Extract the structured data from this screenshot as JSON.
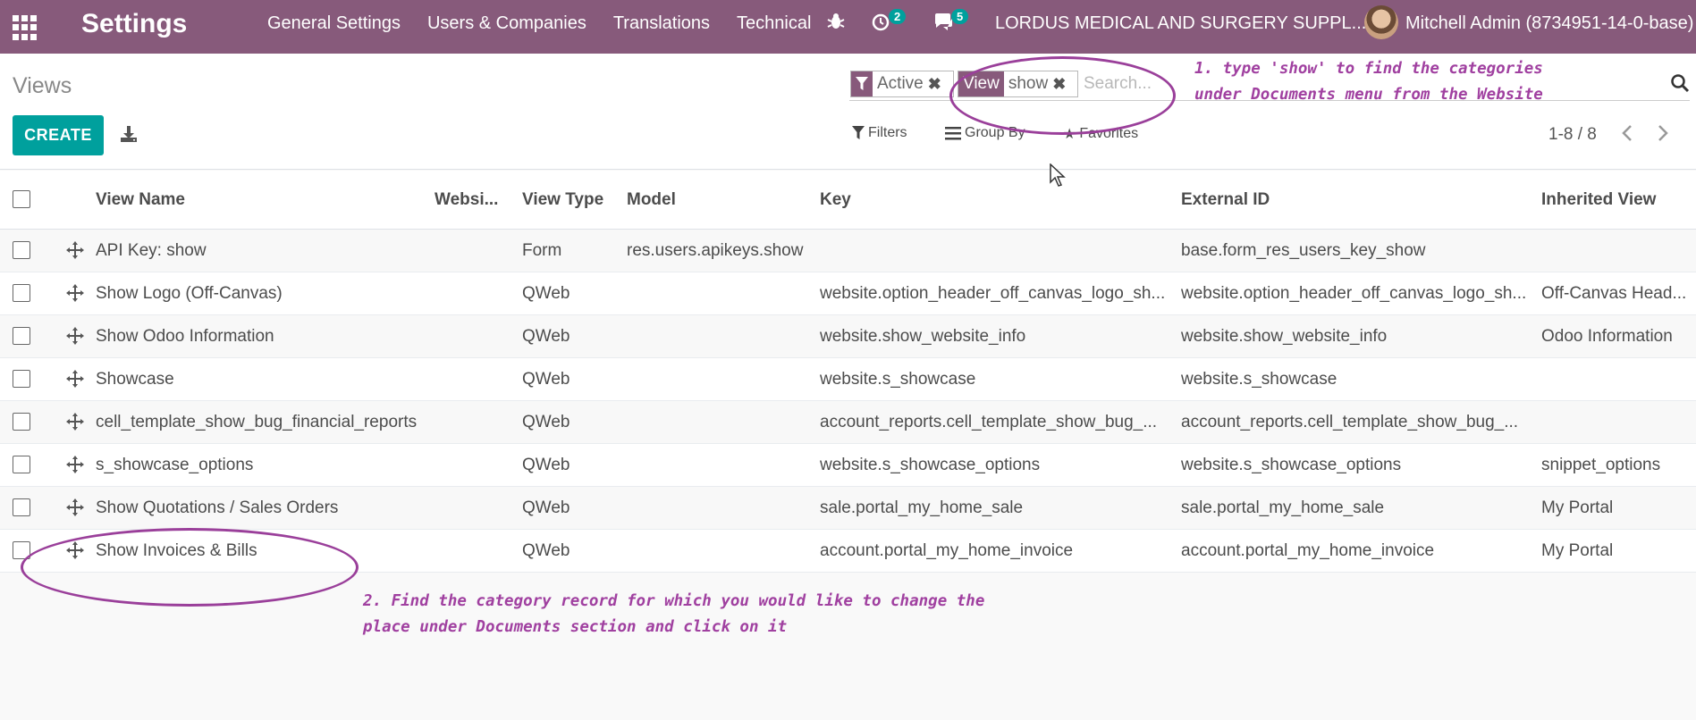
{
  "navbar": {
    "app_title": "Settings",
    "menu": [
      "General Settings",
      "Users & Companies",
      "Translations",
      "Technical"
    ],
    "activity_count": "2",
    "message_count": "5",
    "company": "LORDUS MEDICAL AND SURGERY SUPPL...",
    "user": "Mitchell Admin (8734951-14-0-base)"
  },
  "control": {
    "breadcrumb": "Views",
    "create_label": "CREATE",
    "facets": [
      {
        "label": "",
        "value": "Active"
      },
      {
        "label": "View",
        "value": "show"
      }
    ],
    "search_placeholder": "Search...",
    "filters_label": "Filters",
    "groupby_label": "Group By",
    "favorites_label": "Favorites",
    "pager": "1-8 / 8"
  },
  "table": {
    "headers": {
      "name": "View Name",
      "website": "Websi...",
      "type": "View Type",
      "model": "Model",
      "key": "Key",
      "external_id": "External ID",
      "inherited": "Inherited View"
    },
    "rows": [
      {
        "name": "API Key: show",
        "type": "Form",
        "model": "res.users.apikeys.show",
        "key": "",
        "external_id": "base.form_res_users_key_show",
        "inherited": ""
      },
      {
        "name": "Show Logo (Off-Canvas)",
        "type": "QWeb",
        "model": "",
        "key": "website.option_header_off_canvas_logo_sh...",
        "external_id": "website.option_header_off_canvas_logo_sh...",
        "inherited": "Off-Canvas Head..."
      },
      {
        "name": "Show Odoo Information",
        "type": "QWeb",
        "model": "",
        "key": "website.show_website_info",
        "external_id": "website.show_website_info",
        "inherited": "Odoo Information"
      },
      {
        "name": "Showcase",
        "type": "QWeb",
        "model": "",
        "key": "website.s_showcase",
        "external_id": "website.s_showcase",
        "inherited": ""
      },
      {
        "name": "cell_template_show_bug_financial_reports",
        "type": "QWeb",
        "model": "",
        "key": "account_reports.cell_template_show_bug_...",
        "external_id": "account_reports.cell_template_show_bug_...",
        "inherited": ""
      },
      {
        "name": "s_showcase_options",
        "type": "QWeb",
        "model": "",
        "key": "website.s_showcase_options",
        "external_id": "website.s_showcase_options",
        "inherited": "snippet_options"
      },
      {
        "name": "Show Quotations / Sales Orders",
        "type": "QWeb",
        "model": "",
        "key": "sale.portal_my_home_sale",
        "external_id": "sale.portal_my_home_sale",
        "inherited": "My Portal"
      },
      {
        "name": "Show Invoices & Bills",
        "type": "QWeb",
        "model": "",
        "key": "account.portal_my_home_invoice",
        "external_id": "account.portal_my_home_invoice",
        "inherited": "My Portal"
      }
    ]
  },
  "annotations": {
    "step1": "1. type 'show' to find the categories\nunder Documents menu from the Website",
    "step2": "2. Find the category record for which you would like to change the\nplace under Documents section and click on it"
  },
  "colors": {
    "brand": "#875a7b",
    "primary": "#00a09d",
    "annotation": "#a040a0"
  }
}
